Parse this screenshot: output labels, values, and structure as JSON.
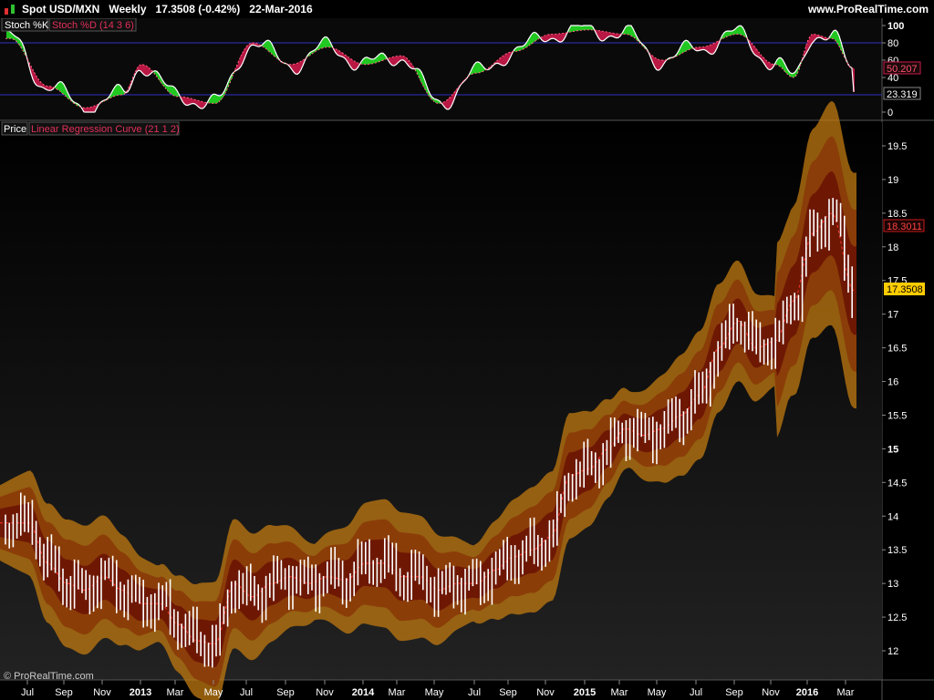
{
  "header": {
    "symbol": "Spot USD/MXN",
    "timeframe": "Weekly",
    "last_price": "17.3508",
    "change": "(-0.42%)",
    "date": "22-Mar-2016",
    "website": "www.ProRealTime.com"
  },
  "stoch_panel": {
    "label_k": "Stoch %K",
    "label_d": "Stoch %D (14 3 6)",
    "value_d": "50.207",
    "value_k": "23.319",
    "y_ticks": [
      "100",
      "80",
      "60",
      "40",
      "0"
    ]
  },
  "price_panel": {
    "label_price": "Price",
    "label_lrc": "Linear Regression Curve (21 1 2)",
    "value_lrc": "18.3011",
    "value_price": "17.3508",
    "y_ticks": [
      "19.5",
      "19",
      "18.5",
      "18",
      "17.5",
      "17",
      "16.5",
      "16",
      "15.5",
      "15",
      "14.5",
      "14",
      "13.5",
      "13",
      "12.5",
      "12"
    ]
  },
  "x_axis": {
    "labels": [
      "Jul",
      "Sep",
      "Nov",
      "2013",
      "Mar",
      "May",
      "Jul",
      "Sep",
      "Nov",
      "2014",
      "Mar",
      "May",
      "Jul",
      "Sep",
      "Nov",
      "2015",
      "Mar",
      "May",
      "Jul",
      "Sep",
      "Nov",
      "2016",
      "Mar"
    ]
  },
  "footer": {
    "copyright": "© ProRealTime.com"
  },
  "colors": {
    "stoch_up": "#22dd22",
    "stoch_down": "#cc1a4a",
    "stoch_line": "#ffffff",
    "band_outer": "#c07a10",
    "band_mid": "#8a3a08",
    "band_inner": "#6a1404",
    "lrc_line": "#ff3030",
    "price_badge": "#ffcc00",
    "level_line": "#3030c0"
  },
  "chart_data": {
    "type": "bar",
    "title": "Spot USD/MXN Weekly",
    "timeframe": "Weekly",
    "x_range": [
      "2012-06",
      "2016-03-22"
    ],
    "price_ylim": [
      11.8,
      19.7
    ],
    "stoch_ylim": [
      0,
      100
    ],
    "stoch_levels": [
      20,
      80
    ],
    "price_close_approx": [
      [
        "2012-07",
        13.9
      ],
      [
        "2012-08",
        13.3
      ],
      [
        "2012-09",
        13.0
      ],
      [
        "2012-10",
        12.9
      ],
      [
        "2012-11",
        13.1
      ],
      [
        "2012-12",
        12.9
      ],
      [
        "2013-01",
        12.7
      ],
      [
        "2013-02",
        12.7
      ],
      [
        "2013-03",
        12.4
      ],
      [
        "2013-04",
        12.15
      ],
      [
        "2013-05",
        12.1
      ],
      [
        "2013-06",
        13.0
      ],
      [
        "2013-07",
        12.8
      ],
      [
        "2013-08",
        13.0
      ],
      [
        "2013-09",
        13.1
      ],
      [
        "2013-10",
        13.0
      ],
      [
        "2013-11",
        13.1
      ],
      [
        "2013-12",
        13.05
      ],
      [
        "2014-01",
        13.3
      ],
      [
        "2014-02",
        13.3
      ],
      [
        "2014-03",
        13.1
      ],
      [
        "2014-04",
        13.1
      ],
      [
        "2014-05",
        12.9
      ],
      [
        "2014-06",
        13.0
      ],
      [
        "2014-07",
        13.0
      ],
      [
        "2014-08",
        13.2
      ],
      [
        "2014-09",
        13.4
      ],
      [
        "2014-10",
        13.5
      ],
      [
        "2014-11",
        13.7
      ],
      [
        "2014-12",
        14.6
      ],
      [
        "2015-01",
        14.7
      ],
      [
        "2015-02",
        15.0
      ],
      [
        "2015-03",
        15.3
      ],
      [
        "2015-04",
        15.2
      ],
      [
        "2015-05",
        15.3
      ],
      [
        "2015-06",
        15.5
      ],
      [
        "2015-07",
        15.8
      ],
      [
        "2015-08",
        16.5
      ],
      [
        "2015-09",
        16.9
      ],
      [
        "2015-10",
        16.5
      ],
      [
        "2015-11",
        16.6
      ],
      [
        "2015-12",
        17.2
      ],
      [
        "2016-01",
        18.2
      ],
      [
        "2016-02",
        18.5
      ],
      [
        "2016-03-22",
        17.35
      ]
    ],
    "stoch_d_approx": [
      [
        "2012-06",
        85
      ],
      [
        "2012-08",
        30
      ],
      [
        "2012-10",
        5
      ],
      [
        "2012-12",
        20
      ],
      [
        "2013-01",
        55
      ],
      [
        "2013-03",
        18
      ],
      [
        "2013-05",
        10
      ],
      [
        "2013-07",
        80
      ],
      [
        "2013-09",
        55
      ],
      [
        "2013-11",
        75
      ],
      [
        "2014-01",
        55
      ],
      [
        "2014-03",
        65
      ],
      [
        "2014-05",
        10
      ],
      [
        "2014-07",
        45
      ],
      [
        "2014-09",
        70
      ],
      [
        "2014-11",
        90
      ],
      [
        "2015-01",
        95
      ],
      [
        "2015-03",
        90
      ],
      [
        "2015-05",
        60
      ],
      [
        "2015-07",
        75
      ],
      [
        "2015-09",
        90
      ],
      [
        "2015-11",
        55
      ],
      [
        "2015-12",
        40
      ],
      [
        "2016-01",
        90
      ],
      [
        "2016-02",
        85
      ],
      [
        "2016-03-22",
        50.207
      ]
    ],
    "last": {
      "price": 17.3508,
      "lrc": 18.3011,
      "stoch_d": 50.207,
      "stoch_k": 23.319
    }
  }
}
